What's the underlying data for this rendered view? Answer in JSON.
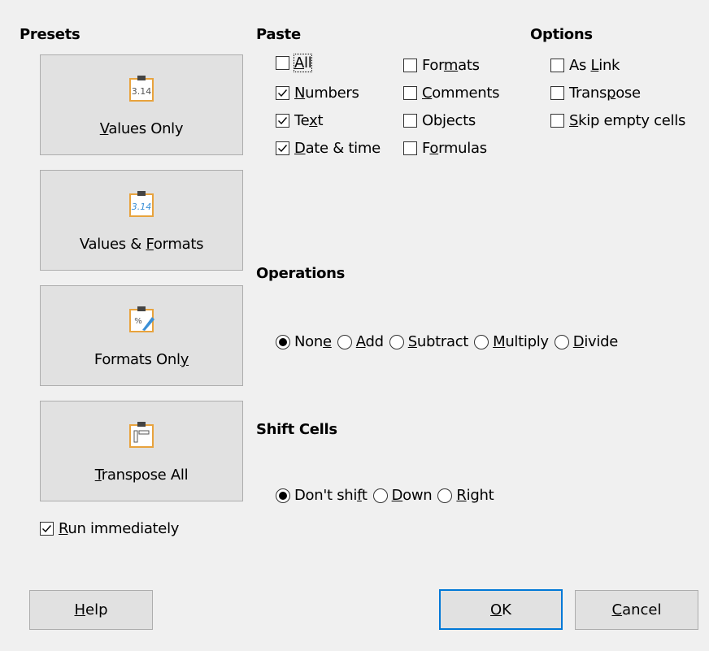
{
  "presets": {
    "heading": "Presets",
    "items": [
      {
        "label_pre": "",
        "label_ul": "V",
        "label_post": "alues Only",
        "icon": "clipboard-numbers-icon",
        "icon_text": "3.14"
      },
      {
        "label_pre": "Values & ",
        "label_ul": "F",
        "label_post": "ormats",
        "icon": "clipboard-formatted-numbers-icon",
        "icon_text": "3.14"
      },
      {
        "label_pre": "Formats Onl",
        "label_ul": "y",
        "label_post": "",
        "icon": "clipboard-formats-icon",
        "icon_text": "%"
      },
      {
        "label_pre": "",
        "label_ul": "T",
        "label_post": "ranspose All",
        "icon": "clipboard-transpose-icon",
        "icon_text": ""
      }
    ],
    "run_immediately": {
      "pre": "",
      "ul": "R",
      "post": "un immediately",
      "checked": true
    }
  },
  "paste": {
    "heading": "Paste",
    "col1": [
      {
        "pre": "",
        "ul": "A",
        "post": "ll",
        "checked": false
      },
      {
        "pre": "",
        "ul": "N",
        "post": "umbers",
        "checked": true
      },
      {
        "pre": "Te",
        "ul": "x",
        "post": "t",
        "checked": true
      },
      {
        "pre": "",
        "ul": "D",
        "post": "ate & time",
        "checked": true
      }
    ],
    "col2": [
      {
        "pre": "For",
        "ul": "m",
        "post": "ats",
        "checked": false
      },
      {
        "pre": "",
        "ul": "C",
        "post": "omments",
        "checked": false
      },
      {
        "pre": "Ob",
        "ul": "j",
        "post": "ects",
        "checked": false
      },
      {
        "pre": "F",
        "ul": "o",
        "post": "rmulas",
        "checked": false
      }
    ]
  },
  "options": {
    "heading": "Options",
    "items": [
      {
        "pre": "As ",
        "ul": "L",
        "post": "ink",
        "checked": false
      },
      {
        "pre": "Trans",
        "ul": "p",
        "post": "ose",
        "checked": false
      },
      {
        "pre": "",
        "ul": "S",
        "post": "kip empty cells",
        "checked": false
      }
    ]
  },
  "operations": {
    "heading": "Operations",
    "items": [
      {
        "pre": "Non",
        "ul": "e",
        "post": "",
        "selected": true
      },
      {
        "pre": "",
        "ul": "A",
        "post": "dd",
        "selected": false
      },
      {
        "pre": "",
        "ul": "S",
        "post": "ubtract",
        "selected": false
      },
      {
        "pre": "",
        "ul": "M",
        "post": "ultiply",
        "selected": false
      },
      {
        "pre": "",
        "ul": "D",
        "post": "ivide",
        "selected": false
      }
    ]
  },
  "shift_cells": {
    "heading": "Shift Cells",
    "items": [
      {
        "pre": "Don't shi",
        "ul": "f",
        "post": "t",
        "selected": true
      },
      {
        "pre": "",
        "ul": "D",
        "post": "own",
        "selected": false
      },
      {
        "pre": "",
        "ul": "R",
        "post": "ight",
        "selected": false
      }
    ]
  },
  "buttons": {
    "help": {
      "pre": "",
      "ul": "H",
      "post": "elp"
    },
    "ok": {
      "pre": "",
      "ul": "O",
      "post": "K"
    },
    "cancel": {
      "pre": "",
      "ul": "C",
      "post": "ancel"
    }
  },
  "colors": {
    "accent": "#0078d7",
    "icon_orange": "#e8a33d",
    "icon_blue": "#3a8fd6"
  }
}
